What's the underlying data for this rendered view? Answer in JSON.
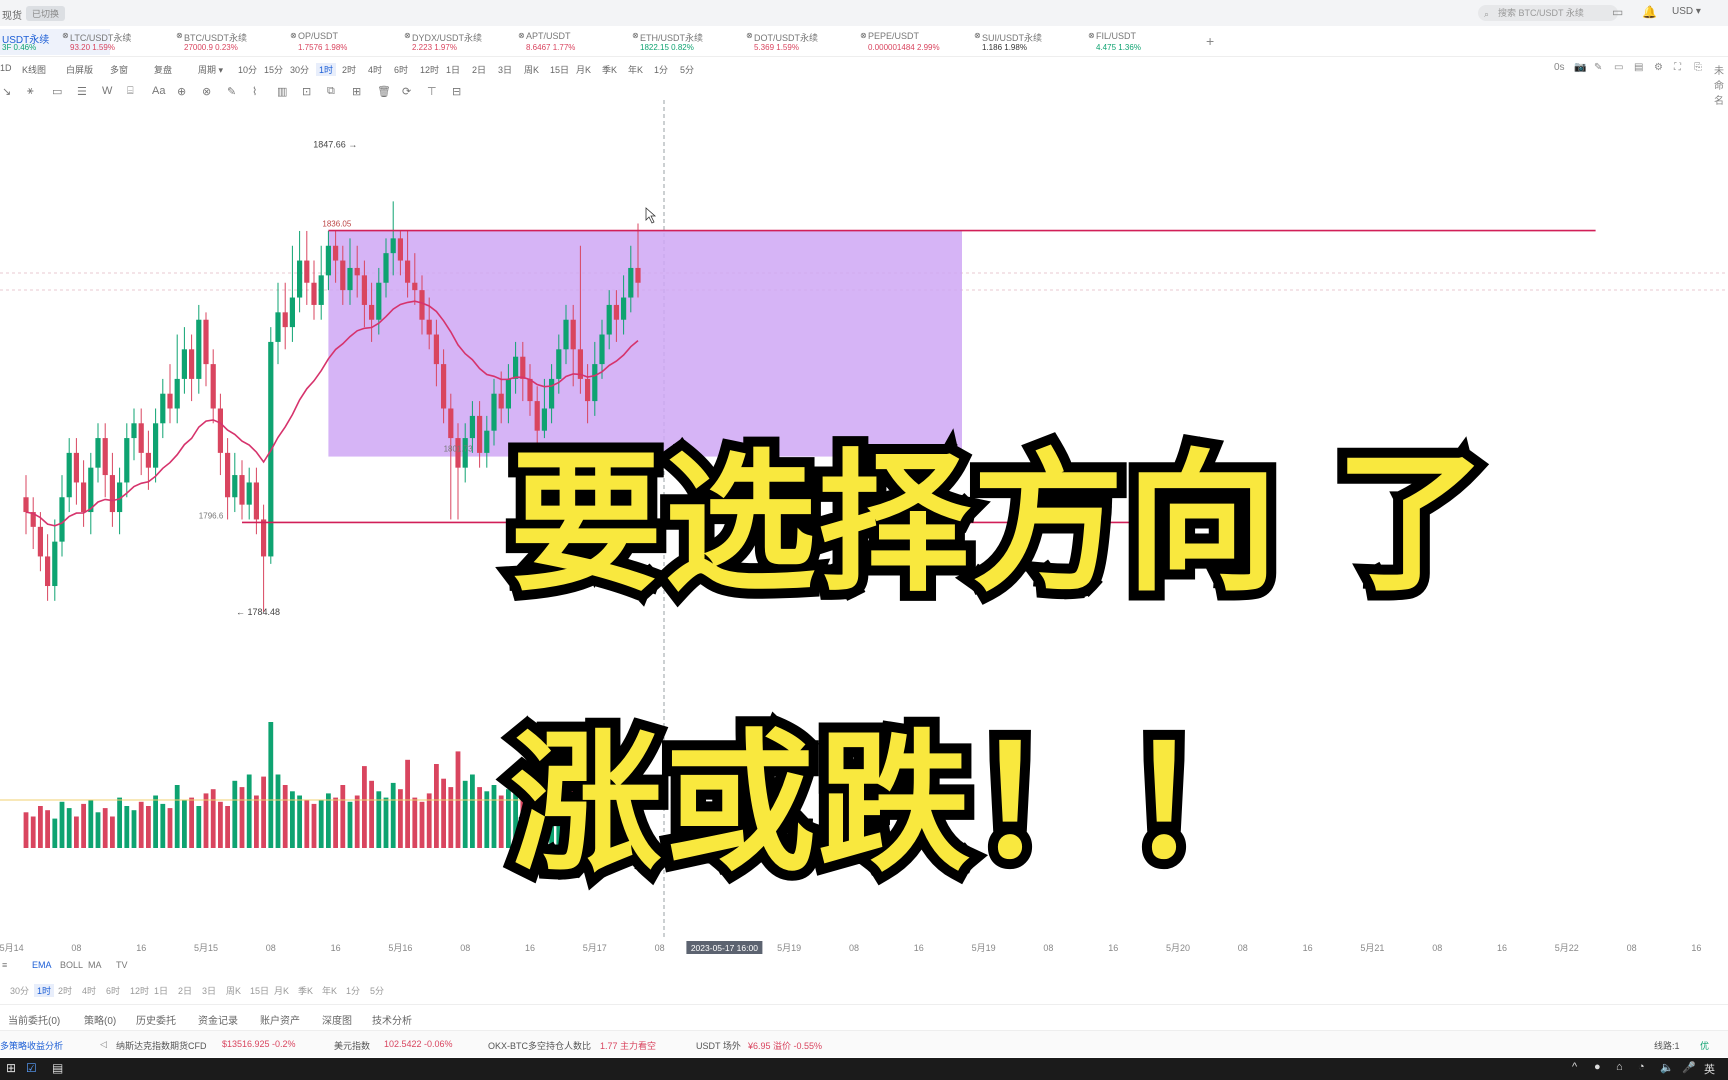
{
  "topbar": {
    "brand": "现货",
    "pill": "已切换",
    "search_placeholder": "搜索 BTC/USDT 永续",
    "currency": "USD ▾"
  },
  "tickers": [
    {
      "name": "USDT永续",
      "price": "3F 0.46%",
      "color": "#0ea371",
      "active": true
    },
    {
      "name": "LTC/USDT永续",
      "price": "93.20 1.59%",
      "color": "#d9455f"
    },
    {
      "name": "BTC/USDT永续",
      "price": "27000.9 0.23%",
      "color": "#d9455f"
    },
    {
      "name": "OP/USDT",
      "price": "1.7576 1.98%",
      "color": "#d9455f"
    },
    {
      "name": "DYDX/USDT永续",
      "price": "2.223 1.97%",
      "color": "#d9455f"
    },
    {
      "name": "APT/USDT",
      "price": "8.6467 1.77%",
      "color": "#d9455f"
    },
    {
      "name": "ETH/USDT永续",
      "price": "1822.15 0.82%",
      "color": "#0ea371"
    },
    {
      "name": "DOT/USDT永续",
      "price": "5.369 1.59%",
      "color": "#d9455f"
    },
    {
      "name": "PEPE/USDT",
      "price": "0.000001484 2.99%",
      "color": "#d9455f"
    },
    {
      "name": "SUI/USDT永续",
      "price": "1.186 1.98%",
      "color": "#333333"
    },
    {
      "name": "FIL/USDT",
      "price": "4.475 1.36%",
      "color": "#0ea371"
    }
  ],
  "toolbar": {
    "left": [
      "1D",
      "K线图",
      "白屏版",
      "多窗",
      "复盘",
      "周期 ▾"
    ],
    "timeframes": [
      "10分",
      "15分",
      "30分",
      "1时",
      "2时",
      "4时",
      "6时",
      "12时",
      "1日",
      "2日",
      "3日",
      "周K",
      "15日",
      "月K",
      "季K",
      "年K",
      "1分",
      "5分"
    ],
    "selected_tf": "1时"
  },
  "drawing_tools": [
    "↘",
    "⚹",
    "▭",
    "☰",
    "W",
    "⌸",
    "Aa",
    "⊕",
    "⊗",
    "✎",
    "⌇",
    "▥",
    "⊡",
    "⧉",
    "⊞",
    "🗑",
    "⟳",
    "⊤",
    "⊟"
  ],
  "right_tools": [
    "0s",
    "📷",
    "✎",
    "▭",
    "▤",
    "⚙",
    "⛶",
    "⎘",
    "未命名"
  ],
  "chart_data": {
    "type": "candlestick",
    "symbol": "ETH/USDT永续",
    "interval": "1时",
    "price_labels": {
      "high": "1847.66 →",
      "low": "← 1784.48",
      "box_top": "1836.05",
      "box_bottom": "1801.73",
      "support": "1796.6"
    },
    "ylim": [
      1778,
      1851
    ],
    "range_box": {
      "x_start": 42,
      "x_end": 130,
      "top": 1836.05,
      "bottom": 1805.5,
      "color": "#cfa7f5"
    },
    "lines": [
      {
        "name": "resistance",
        "y": 1836.05,
        "x_start": 42,
        "x_end": 218,
        "color": "#d11f58"
      },
      {
        "name": "support",
        "y": 1796.6,
        "x_start": 30,
        "x_end": 165,
        "color": "#d11f58"
      }
    ],
    "x_ticks": [
      "5月14",
      "08",
      "16",
      "5月15",
      "08",
      "16",
      "5月16",
      "08",
      "16",
      "5月17",
      "08",
      "2023-05-17 16:00",
      "5月19",
      "08",
      "16",
      "5月19",
      "08",
      "16",
      "5月20",
      "08",
      "16",
      "5月21",
      "08",
      "16",
      "5月22",
      "08",
      "16",
      "5月23",
      "08"
    ],
    "x_tick_index": [
      -2,
      7,
      16,
      25,
      34,
      43,
      52,
      61,
      70,
      79,
      88,
      97,
      106,
      115,
      124,
      133,
      142,
      151,
      160,
      169,
      178,
      187,
      196,
      205,
      214,
      223,
      232,
      241,
      250
    ],
    "candles": [
      [
        1800,
        1798,
        1803,
        1795
      ],
      [
        1798,
        1796,
        1800,
        1793
      ],
      [
        1796,
        1792,
        1798,
        1790
      ],
      [
        1792,
        1788,
        1795,
        1786
      ],
      [
        1788,
        1794,
        1797,
        1786
      ],
      [
        1794,
        1800,
        1803,
        1792
      ],
      [
        1800,
        1806,
        1808,
        1798
      ],
      [
        1806,
        1802,
        1808,
        1799
      ],
      [
        1802,
        1798,
        1805,
        1796
      ],
      [
        1798,
        1804,
        1806,
        1795
      ],
      [
        1804,
        1808,
        1810,
        1802
      ],
      [
        1808,
        1803,
        1810,
        1800
      ],
      [
        1803,
        1798,
        1806,
        1796
      ],
      [
        1798,
        1802,
        1804,
        1795
      ],
      [
        1802,
        1808,
        1810,
        1800
      ],
      [
        1808,
        1810,
        1812,
        1805
      ],
      [
        1810,
        1806,
        1812,
        1803
      ],
      [
        1806,
        1804,
        1809,
        1801
      ],
      [
        1804,
        1810,
        1812,
        1802
      ],
      [
        1810,
        1814,
        1816,
        1808
      ],
      [
        1814,
        1812,
        1818,
        1810
      ],
      [
        1812,
        1816,
        1822,
        1810
      ],
      [
        1816,
        1820,
        1823,
        1814
      ],
      [
        1820,
        1816,
        1822,
        1813
      ],
      [
        1816,
        1824,
        1826,
        1814
      ],
      [
        1824,
        1818,
        1825,
        1815
      ],
      [
        1818,
        1812,
        1820,
        1810
      ],
      [
        1812,
        1806,
        1814,
        1803
      ],
      [
        1806,
        1800,
        1808,
        1797
      ],
      [
        1800,
        1803,
        1806,
        1798
      ],
      [
        1803,
        1799,
        1805,
        1797
      ],
      [
        1799,
        1802,
        1804,
        1797
      ],
      [
        1802,
        1797,
        1804,
        1795
      ],
      [
        1797,
        1792,
        1799,
        1784.5
      ],
      [
        1792,
        1821,
        1823,
        1791
      ],
      [
        1821,
        1825,
        1829,
        1818
      ],
      [
        1825,
        1823,
        1829,
        1820
      ],
      [
        1823,
        1827,
        1834,
        1821
      ],
      [
        1827,
        1832,
        1836,
        1825
      ],
      [
        1832,
        1829,
        1836,
        1826
      ],
      [
        1829,
        1826,
        1832,
        1824
      ],
      [
        1826,
        1830,
        1834,
        1824
      ],
      [
        1830,
        1834,
        1836,
        1828
      ],
      [
        1834,
        1832,
        1836,
        1829
      ],
      [
        1832,
        1828,
        1834,
        1826
      ],
      [
        1828,
        1831,
        1835,
        1826
      ],
      [
        1831,
        1830,
        1834,
        1827
      ],
      [
        1830,
        1826,
        1832,
        1823
      ],
      [
        1826,
        1824,
        1829,
        1821
      ],
      [
        1824,
        1829,
        1831,
        1822
      ],
      [
        1829,
        1833,
        1835,
        1827
      ],
      [
        1833,
        1835,
        1840,
        1830
      ],
      [
        1835,
        1832,
        1836,
        1830
      ],
      [
        1832,
        1829,
        1836,
        1827
      ],
      [
        1829,
        1828,
        1833,
        1826
      ],
      [
        1828,
        1824,
        1830,
        1822
      ],
      [
        1824,
        1822,
        1827,
        1820
      ],
      [
        1822,
        1818,
        1824,
        1815
      ],
      [
        1818,
        1812,
        1820,
        1810
      ],
      [
        1812,
        1808,
        1814,
        1797
      ],
      [
        1808,
        1804,
        1810,
        1797
      ],
      [
        1804,
        1808,
        1810,
        1802
      ],
      [
        1808,
        1811,
        1813,
        1806
      ],
      [
        1811,
        1806,
        1813,
        1804
      ],
      [
        1806,
        1809,
        1811,
        1804
      ],
      [
        1809,
        1814,
        1816,
        1807
      ],
      [
        1814,
        1812,
        1817,
        1810
      ],
      [
        1812,
        1816,
        1818,
        1810
      ],
      [
        1816,
        1819,
        1821,
        1814
      ],
      [
        1819,
        1816,
        1821,
        1813
      ],
      [
        1816,
        1813,
        1818,
        1811
      ],
      [
        1813,
        1809,
        1815,
        1807
      ],
      [
        1809,
        1812,
        1816,
        1808
      ],
      [
        1812,
        1816,
        1818,
        1810
      ],
      [
        1816,
        1820,
        1822,
        1814
      ],
      [
        1820,
        1824,
        1826,
        1818
      ],
      [
        1824,
        1820,
        1826,
        1815
      ],
      [
        1820,
        1816,
        1834,
        1814
      ],
      [
        1816,
        1813,
        1818,
        1810
      ],
      [
        1813,
        1818,
        1821,
        1811
      ],
      [
        1818,
        1822,
        1824,
        1816
      ],
      [
        1822,
        1826,
        1828,
        1820
      ],
      [
        1826,
        1824,
        1828,
        1821
      ],
      [
        1824,
        1827,
        1830,
        1822
      ],
      [
        1827,
        1831,
        1834,
        1825
      ],
      [
        1831,
        1829,
        1837,
        1827
      ]
    ],
    "volume": [
      34,
      30,
      40,
      36,
      28,
      44,
      38,
      30,
      42,
      46,
      34,
      38,
      30,
      48,
      40,
      36,
      44,
      40,
      50,
      42,
      38,
      60,
      46,
      48,
      40,
      52,
      56,
      44,
      40,
      64,
      58,
      70,
      50,
      68,
      120,
      70,
      60,
      54,
      50,
      46,
      42,
      46,
      52,
      48,
      60,
      44,
      50,
      78,
      64,
      54,
      48,
      62,
      56,
      84,
      48,
      44,
      52,
      80,
      66,
      58,
      92,
      64,
      70,
      58,
      54,
      60,
      50,
      56,
      52,
      60,
      88,
      60,
      54,
      50,
      48,
      70,
      64,
      58,
      46,
      52,
      60,
      54,
      68,
      56,
      50,
      74,
      60
    ],
    "indicators": [
      "EMA",
      "BOLL",
      "MA",
      "TV"
    ],
    "indicator_selected": "EMA",
    "bottom_timeframes": [
      "30分",
      "1时",
      "2时",
      "4时",
      "6时",
      "12时",
      "1日",
      "2日",
      "3日",
      "周K",
      "15日",
      "月K",
      "季K",
      "年K",
      "1分",
      "5分"
    ],
    "bottom_selected": "1时"
  },
  "orders_tabs": [
    "当前委托(0)",
    "策略(0)",
    "历史委托",
    "资金记录",
    "账户资产",
    "深度图",
    "技术分析"
  ],
  "statusbar": [
    {
      "text": "多策略收益分析",
      "color": "#1d5fd6"
    },
    {
      "text": "纳斯达克指数期货CFD",
      "color": "#555"
    },
    {
      "text": "$13516.925 -0.2%",
      "color": "#d9455f"
    },
    {
      "text": "美元指数",
      "color": "#555"
    },
    {
      "text": "102.5422 -0.06%",
      "color": "#d9455f"
    },
    {
      "text": "OKX-BTC多空持仓人数比",
      "color": "#555"
    },
    {
      "text": "1.77 主力看空",
      "color": "#d9455f"
    },
    {
      "text": "USDT 场外",
      "color": "#555"
    },
    {
      "text": "¥6.95 溢价 -0.55%",
      "color": "#d9455f"
    },
    {
      "text": "线路:1",
      "color": "#555"
    },
    {
      "text": "优",
      "color": "#0ea371"
    }
  ],
  "taskbar_right": [
    "^",
    "●",
    "⌂",
    "◔",
    "🔈",
    "🎤",
    "英"
  ],
  "overlay": {
    "line1": "要选择方向 了",
    "line2": "涨或跌！！"
  },
  "colors": {
    "up": "#0ea371",
    "down": "#d9455f",
    "ema": "#d6336c",
    "accent": "#1d5fd6",
    "crosshair": "#9aa0a6"
  }
}
